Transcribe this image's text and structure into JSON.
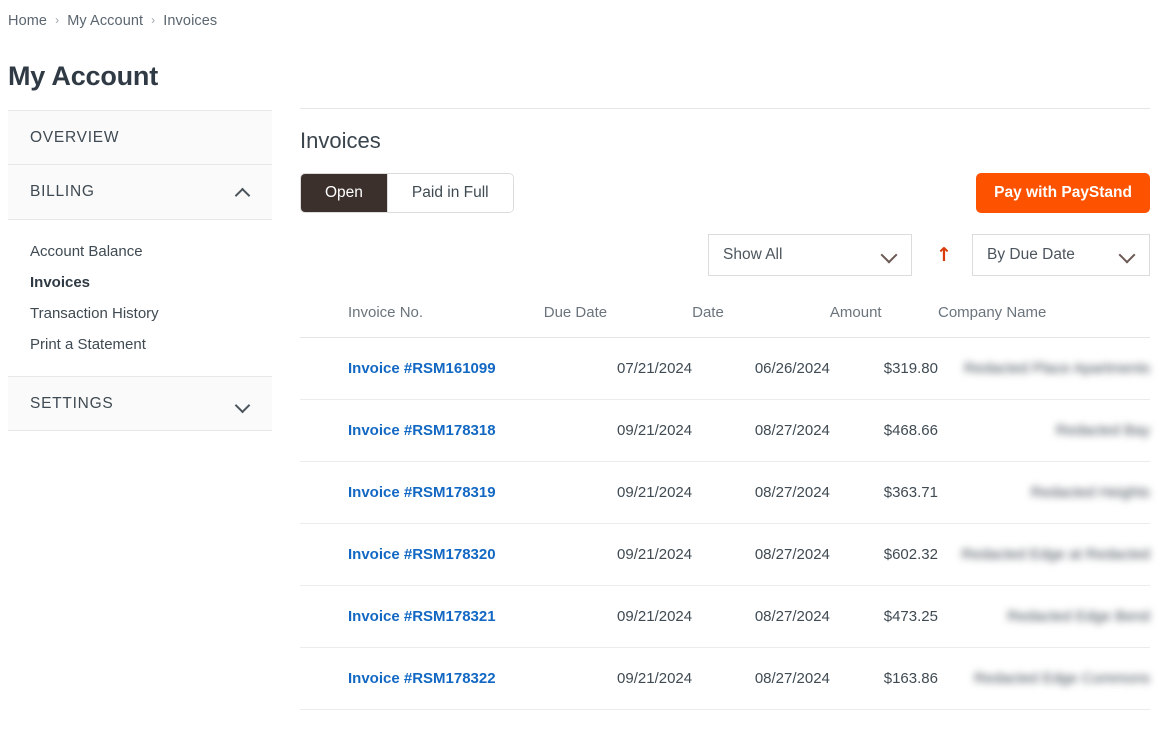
{
  "breadcrumb": {
    "items": [
      {
        "label": "Home"
      },
      {
        "label": "My Account"
      },
      {
        "label": "Invoices"
      }
    ],
    "separator": "›"
  },
  "page": {
    "title": "My Account"
  },
  "sidebar": {
    "sections": [
      {
        "label": "OVERVIEW",
        "expanded": false,
        "chevron": null,
        "items": []
      },
      {
        "label": "BILLING",
        "expanded": true,
        "chevron": "chevron-up-icon",
        "items": [
          {
            "label": "Account Balance",
            "active": false
          },
          {
            "label": "Invoices",
            "active": true
          },
          {
            "label": "Transaction History",
            "active": false
          },
          {
            "label": "Print a Statement",
            "active": false
          }
        ]
      },
      {
        "label": "SETTINGS",
        "expanded": false,
        "chevron": "chevron-down-icon",
        "items": []
      }
    ]
  },
  "main": {
    "heading": "Invoices",
    "tabs": [
      {
        "label": "Open",
        "active": true
      },
      {
        "label": "Paid in Full",
        "active": false
      }
    ],
    "pay_button": {
      "label": "Pay with PayStand",
      "color": "#fd5200"
    },
    "filters": {
      "show_filter": {
        "value": "Show All",
        "options": [
          "Show All"
        ]
      },
      "sort_direction": {
        "icon": "arrow-up-icon",
        "value": "ascending",
        "glyph": "↑",
        "color": "#d93b0b"
      },
      "sort_filter": {
        "value": "By Due Date",
        "options": [
          "By Due Date"
        ]
      }
    },
    "table": {
      "columns": [
        "Invoice No.",
        "Due Date",
        "Date",
        "Amount",
        "Company Name"
      ],
      "rows": [
        {
          "invoice_no": "Invoice #RSM161099",
          "due_date": "07/21/2024",
          "date": "06/26/2024",
          "amount": "$319.80",
          "company_name": "Redacted Place Apartments"
        },
        {
          "invoice_no": "Invoice #RSM178318",
          "due_date": "09/21/2024",
          "date": "08/27/2024",
          "amount": "$468.66",
          "company_name": "Redacted Bay"
        },
        {
          "invoice_no": "Invoice #RSM178319",
          "due_date": "09/21/2024",
          "date": "08/27/2024",
          "amount": "$363.71",
          "company_name": "Redacted Heights"
        },
        {
          "invoice_no": "Invoice #RSM178320",
          "due_date": "09/21/2024",
          "date": "08/27/2024",
          "amount": "$602.32",
          "company_name": "Redacted Edge at Redacted"
        },
        {
          "invoice_no": "Invoice #RSM178321",
          "due_date": "09/21/2024",
          "date": "08/27/2024",
          "amount": "$473.25",
          "company_name": "Redacted Edge Bend"
        },
        {
          "invoice_no": "Invoice #RSM178322",
          "due_date": "09/21/2024",
          "date": "08/27/2024",
          "amount": "$163.86",
          "company_name": "Redacted Edge Commons"
        }
      ]
    }
  }
}
